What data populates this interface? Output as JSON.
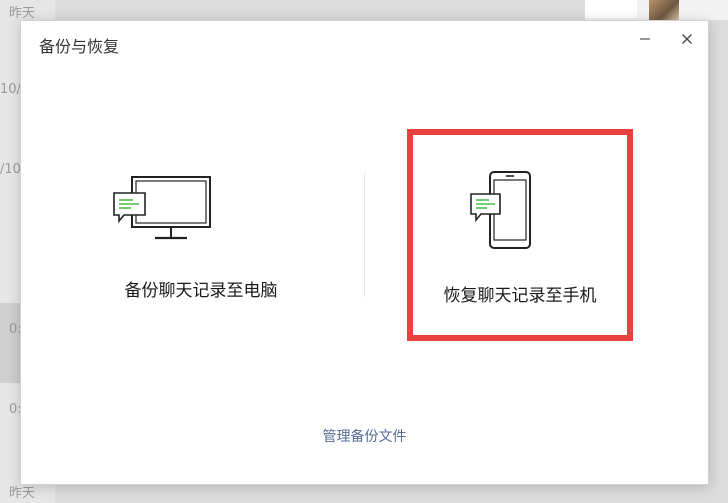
{
  "background": {
    "chat_list_labels": [
      "昨天",
      "10/",
      "/10",
      "0:",
      "0:",
      "昨天"
    ]
  },
  "dialog": {
    "title": "备份与恢复",
    "minimize_symbol": "—",
    "close_symbol": "✕",
    "options": [
      {
        "label": "备份聊天记录至电脑",
        "icon": "monitor-chat-icon",
        "selected": false
      },
      {
        "label": "恢复聊天记录至手机",
        "icon": "phone-chat-icon",
        "selected": true
      }
    ],
    "manage_link": "管理备份文件"
  },
  "colors": {
    "accent_green": "#4bbf4b",
    "link_blue": "#576b95",
    "highlight_red": "#e94040"
  }
}
